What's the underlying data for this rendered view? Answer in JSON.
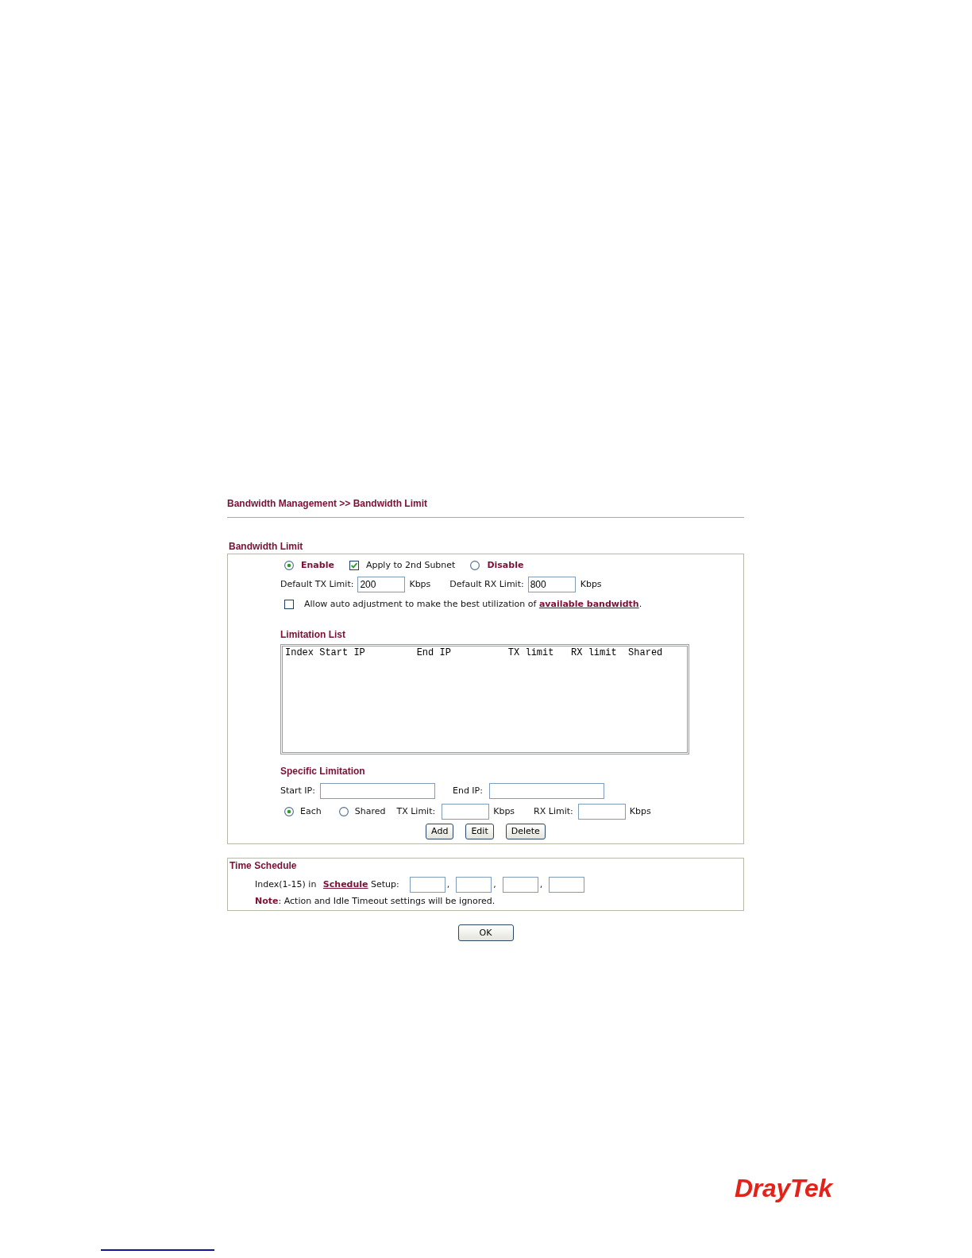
{
  "breadcrumb": "Bandwidth Management >> Bandwidth Limit",
  "bandwidth_limit": {
    "title": "Bandwidth Limit",
    "status": [
      {
        "label": "Enable",
        "selected": true
      },
      {
        "label": "Disable",
        "selected": false
      }
    ],
    "apply_to_2nd_subnet": {
      "label": "Apply to 2nd Subnet",
      "checked": true
    },
    "default_tx": {
      "label": "Default TX Limit:",
      "value": "200",
      "unit": "Kbps"
    },
    "default_rx": {
      "label": "Default RX Limit:",
      "value": "800",
      "unit": "Kbps"
    },
    "auto_adjustment": {
      "checked": false,
      "text": "Allow auto adjustment to make the best utilization of",
      "link": "available bandwidth",
      "after": "."
    },
    "limitation_list": {
      "title": "Limitation List",
      "header": "Index Start IP         End IP          TX limit   RX limit  Shared"
    },
    "specific_limitation": {
      "title": "Specific Limitation",
      "start_ip": {
        "label": "Start IP:"
      },
      "end_ip": {
        "label": "End IP:"
      },
      "share_mode": [
        {
          "label": "Each",
          "selected": true
        },
        {
          "label": "Shared",
          "selected": false
        }
      ],
      "tx_limit": {
        "label": "TX Limit:",
        "unit": "Kbps"
      },
      "rx_limit": {
        "label": "RX Limit:",
        "unit": "Kbps"
      },
      "buttons": [
        "Add",
        "Edit",
        "Delete"
      ]
    }
  },
  "time_schedule": {
    "title": "Time Schedule",
    "index_text": "Index(1-15) in",
    "schedule_link": "Schedule",
    "setup_text": "Setup:",
    "separators": [
      ",",
      ",",
      ","
    ],
    "note": "**Note**: Action and Idle Timeout settings will be ignored."
  },
  "ok_button": "OK",
  "logo": "DrayTek"
}
